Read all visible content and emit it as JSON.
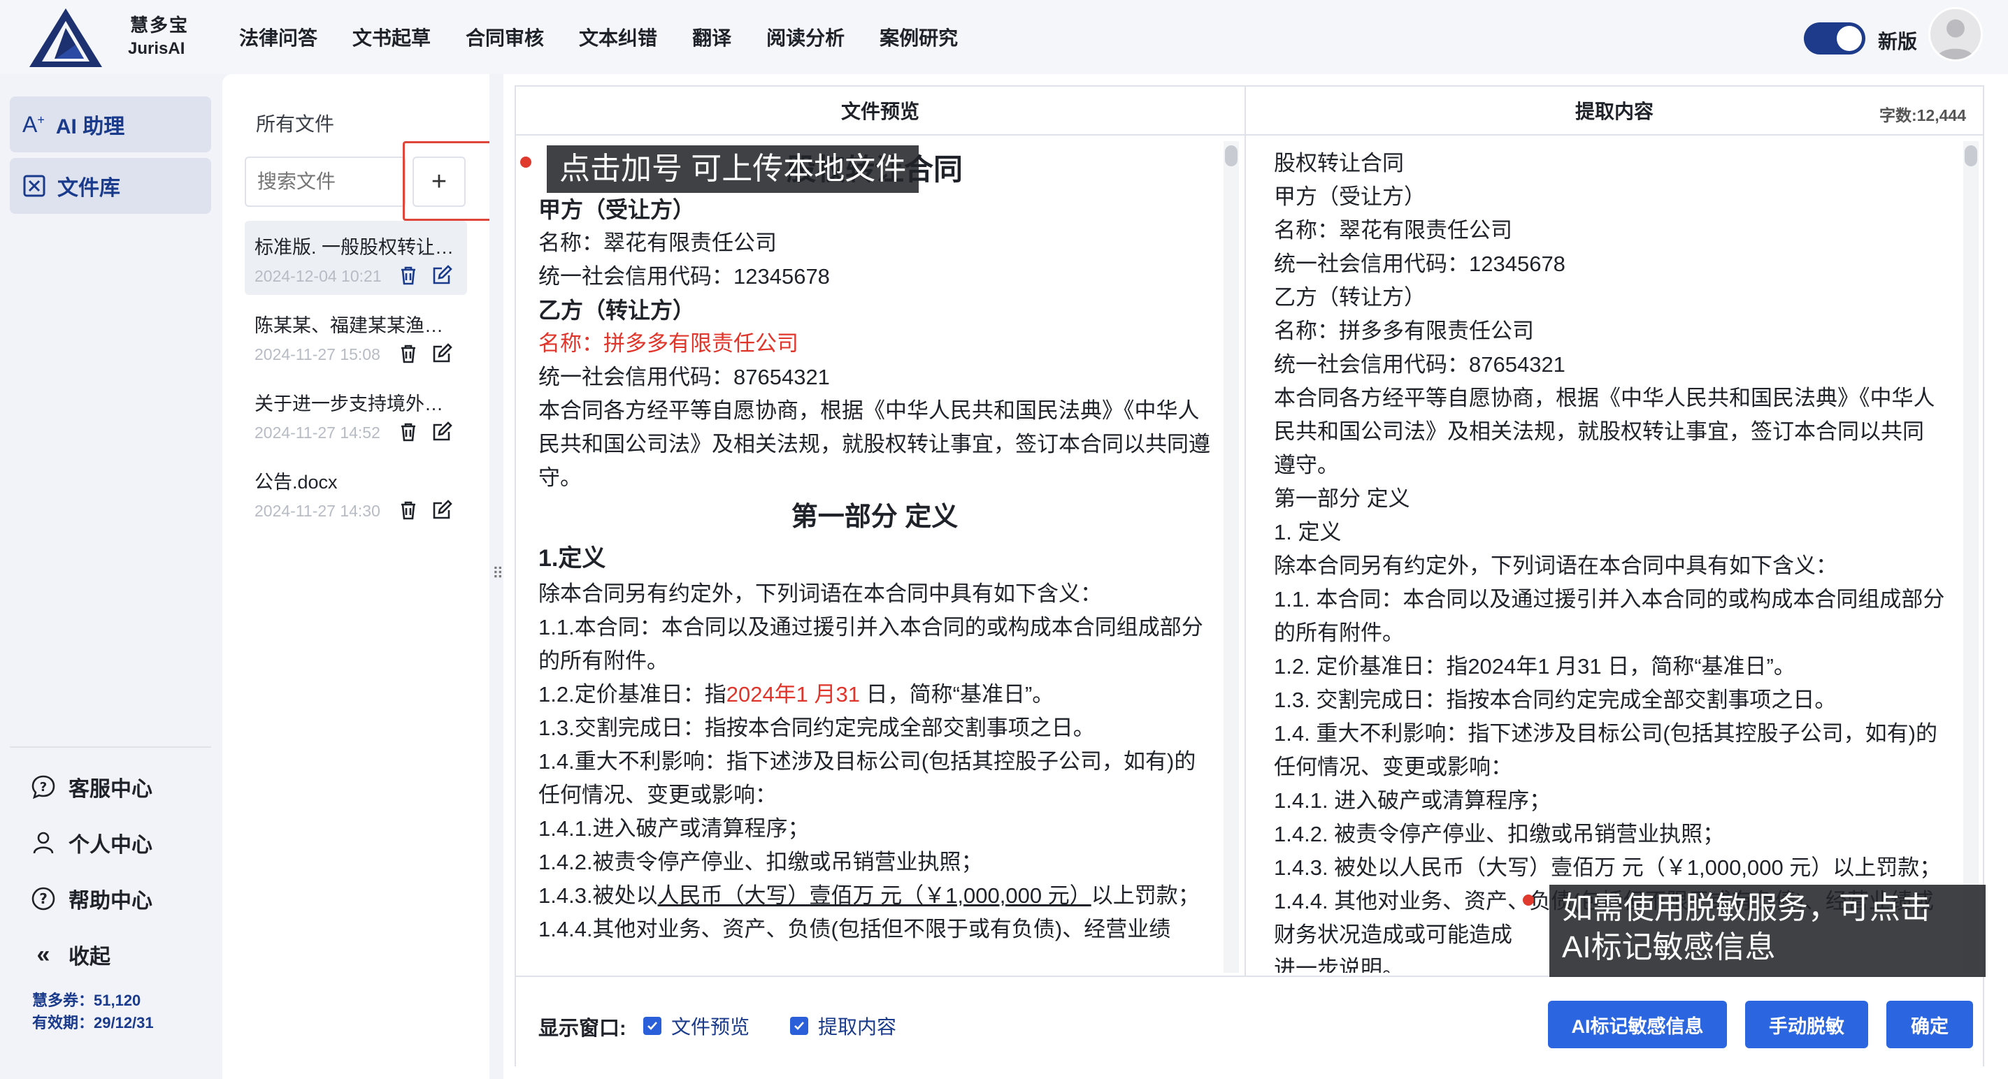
{
  "brand": {
    "name_cn": "慧多宝",
    "name_en": "JurisAI"
  },
  "nav": [
    "法律问答",
    "文书起草",
    "合同审核",
    "文本纠错",
    "翻译",
    "阅读分析",
    "案例研究"
  ],
  "header": {
    "version_label": "新版",
    "version_toggle_on": true
  },
  "sidebar": {
    "main": [
      {
        "label": "AI 助理",
        "icon": "ai-sparkle-icon"
      },
      {
        "label": "文件库",
        "icon": "file-library-icon"
      }
    ],
    "links": [
      {
        "label": "客服中心",
        "icon": "chat-question-icon"
      },
      {
        "label": "个人中心",
        "icon": "user-icon"
      },
      {
        "label": "帮助中心",
        "icon": "help-circle-icon"
      },
      {
        "label": "收起",
        "icon": "double-chevron-left-icon"
      }
    ],
    "quota_label": "慧多券：51,120",
    "expiry_label": "有效期：29/12/31"
  },
  "files": {
    "title": "所有文件",
    "search_placeholder": "搜索文件",
    "add_label": "+",
    "items": [
      {
        "name": "标准版. 一般股权转让协议",
        "date": "2024-12-04 10:21"
      },
      {
        "name": "陈某某、福建某某渔业有限公司",
        "date": "2024-11-27 15:08"
      },
      {
        "name": "关于进一步支持境外机构投资",
        "date": "2024-11-27 14:52"
      },
      {
        "name": "公告.docx",
        "date": "2024-11-27 14:30"
      }
    ]
  },
  "viewer": {
    "preview_header": "文件预览",
    "extract_header": "提取内容",
    "word_count": "字数:12,444",
    "preview": {
      "title": "股权转让合同",
      "party_a": "甲方（受让方）",
      "party_a_name": "名称：翠花有限责任公司",
      "party_a_code": "统一社会信用代码：12345678",
      "party_b": "乙方（转让方）",
      "party_b_name": "名称：拼多多有限责任公司",
      "party_b_code": "统一社会信用代码：87654321",
      "intro": "本合同各方经平等自愿协商，根据《中华人民共和国民法典》《中华人民共和国公司法》及相关法规，就股权转让事宜，签订本合同以共同遵守。",
      "part1": "第一部分 定义",
      "def_heading": "1.定义",
      "def_intro": "除本合同另有约定外，下列词语在本合同中具有如下含义：",
      "d1_1": "1.1.本合同：本合同以及通过援引并入本合同的或构成本合同组成部分的所有附件。",
      "d1_2_prefix": "1.2.定价基准日：指",
      "d1_2_date": "2024年1 月31",
      "d1_2_suffix": " 日，简称“基准日”。",
      "d1_3": "1.3.交割完成日：指按本合同约定完成全部交割事项之日。",
      "d1_4": "1.4.重大不利影响：指下述涉及目标公司(包括其控股子公司，如有)的任何情况、变更或影响：",
      "d1_4_1": "1.4.1.进入破产或清算程序；",
      "d1_4_2": "1.4.2.被责令停产停业、扣缴或吊销营业执照；",
      "d1_4_3_prefix": "1.4.3.被处以",
      "d1_4_3_amount": "人民币（大写）壹佰万 元（￥1,000,000 元）",
      "d1_4_3_suffix": "以上罚款；",
      "d1_4_4": "1.4.4.其他对业务、资产、负债(包括但不限于或有负债)、经营业绩"
    },
    "extract_lines": [
      "股权转让合同",
      "甲方（受让方）",
      "名称：翠花有限责任公司",
      "统一社会信用代码：12345678",
      "乙方（转让方）",
      "名称：拼多多有限责任公司",
      "统一社会信用代码：87654321",
      "本合同各方经平等自愿协商，根据《中华人民共和国民法典》《中华人民共和国公司法》及相关法规，就股权转让事宜，签订本合同以共同遵守。",
      "第一部分 定义",
      "1. 定义",
      "除本合同另有约定外，下列词语在本合同中具有如下含义：",
      "1.1. 本合同：本合同以及通过援引并入本合同的或构成本合同组成部分的所有附件。",
      "1.2. 定价基准日：指2024年1 月31 日，简称“基准日”。",
      "1.3. 交割完成日：指按本合同约定完成全部交割事项之日。",
      "1.4. 重大不利影响：指下述涉及目标公司(包括其控股子公司，如有)的任何情况、变更或影响：",
      "1.4.1. 进入破产或清算程序；",
      "1.4.2. 被责令停产停业、扣缴或吊销营业执照；",
      "1.4.3. 被处以人民币（大写）壹佰万 元（￥1,000,000 元）以上罚款；",
      "1.4.4. 其他对业务、资产、负债(包括但不限于或有负债)、经营业绩或财务状况造成或可能造成",
      "进一步说明。"
    ],
    "footer": {
      "show_label": "显示窗口:",
      "chk_preview": "文件预览",
      "chk_extract": "提取内容",
      "btn_ai": "AI标记敏感信息",
      "btn_manual": "手动脱敏",
      "btn_ok": "确定"
    }
  },
  "tips": {
    "upload": "点击加号 可上传本地文件",
    "desensitize_line1": "如需使用脱敏服务，可点击",
    "desensitize_line2": "AI标记敏感信息"
  },
  "colors": {
    "brand": "#1a3a8c",
    "button": "#2b65e0",
    "highlight": "#e0352b"
  }
}
